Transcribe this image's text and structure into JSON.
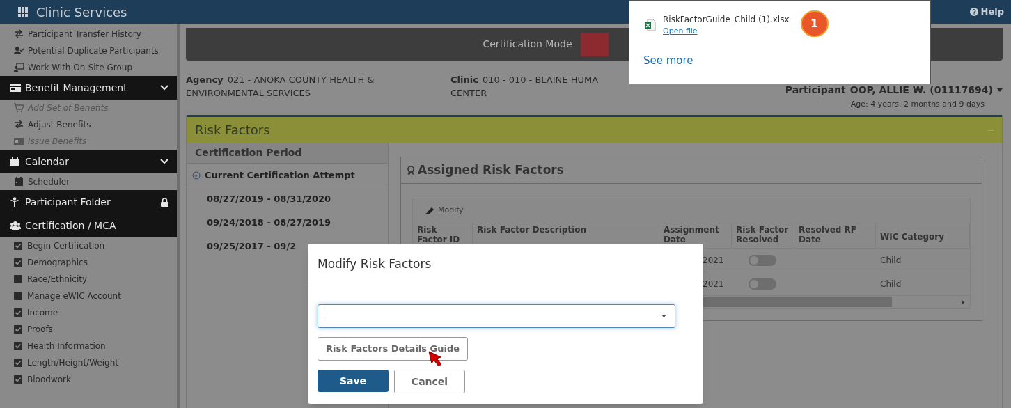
{
  "app_bar": {
    "title": "Clinic Services",
    "help": "Help"
  },
  "sidebar": {
    "items": [
      {
        "kind": "link",
        "label": "Participant Transfer History",
        "disabled": false
      },
      {
        "kind": "link",
        "label": "Potential Duplicate Participants",
        "disabled": false
      },
      {
        "kind": "link",
        "label": "Work With On-Site Group",
        "disabled": false
      },
      {
        "kind": "header",
        "label": "Benefit Management",
        "expanded": true,
        "locked": false
      },
      {
        "kind": "link",
        "label": "Add Set of Benefits",
        "disabled": true
      },
      {
        "kind": "link",
        "label": "Adjust Benefits",
        "disabled": false
      },
      {
        "kind": "link",
        "label": "Issue Benefits",
        "disabled": true
      },
      {
        "kind": "header",
        "label": "Calendar",
        "expanded": true,
        "locked": false
      },
      {
        "kind": "link",
        "label": "Scheduler",
        "disabled": false
      },
      {
        "kind": "header",
        "label": "Participant Folder",
        "expanded": false,
        "locked": true
      },
      {
        "kind": "header",
        "label": "Certification / MCA",
        "expanded": false,
        "locked": false
      },
      {
        "kind": "check",
        "label": "Begin Certification",
        "checked": true
      },
      {
        "kind": "check",
        "label": "Demographics",
        "checked": true
      },
      {
        "kind": "check",
        "label": "Race/Ethnicity",
        "checked": false
      },
      {
        "kind": "check",
        "label": "Manage eWIC Account",
        "checked": false
      },
      {
        "kind": "check",
        "label": "Income",
        "checked": true
      },
      {
        "kind": "check",
        "label": "Proofs",
        "checked": true
      },
      {
        "kind": "check",
        "label": "Health Information",
        "checked": true
      },
      {
        "kind": "check",
        "label": "Length/Height/Weight",
        "checked": true
      },
      {
        "kind": "check",
        "label": "Bloodwork",
        "checked": true
      }
    ]
  },
  "mode_banner": {
    "label": "Certification Mode"
  },
  "agency": {
    "label": "Agency",
    "value": "021 - ANOKA COUNTY HEALTH & ENVIRONMENTAL SERVICES"
  },
  "clinic": {
    "label": "Clinic",
    "value": "010 - 010 - BLAINE HUMA",
    "value_line_2": "CENTER"
  },
  "participant": {
    "label": "Participant",
    "value": "OOP, ALLIE W. (01117694)",
    "age": "Age: 4 years, 2 months and 9 days"
  },
  "risk_factors": {
    "title": "Risk Factors",
    "certification_period": {
      "title": "Certification Period",
      "items": [
        {
          "label": "Current Certification Attempt",
          "selected": true
        },
        {
          "label": "08/27/2019 - 08/31/2020",
          "selected": false
        },
        {
          "label": "09/24/2018 - 08/27/2019",
          "selected": false
        },
        {
          "label": "09/25/2017 - 09/2",
          "selected": false
        }
      ]
    },
    "assigned": {
      "title": "Assigned Risk Factors",
      "modify": "Modify",
      "columns": [
        "Risk Factor ID",
        "Risk Factor Description",
        "Assignment Date",
        "Risk Factor Resolved",
        "Resolved RF Date",
        "WIC Category"
      ],
      "rows": [
        {
          "assignment_date": "2021",
          "resolved": false,
          "wic_category": "Child"
        },
        {
          "assignment_date": "2021",
          "resolved": false,
          "wic_category": "Child"
        }
      ]
    }
  },
  "modal": {
    "title": "Modify Risk Factors",
    "guide_button": "Risk Factors Details Guide",
    "save": "Save",
    "cancel": "Cancel"
  },
  "download_popup": {
    "file_name": "RiskFactorGuide_Child (1).xlsx",
    "open_file": "Open file",
    "see_more": "See more",
    "badge": "1"
  }
}
